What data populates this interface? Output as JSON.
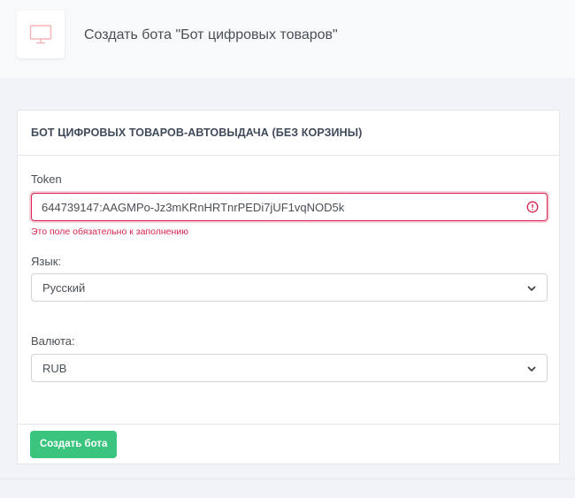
{
  "header": {
    "icon": "monitor-icon",
    "title": "Создать бота \"Бот цифровых товаров\""
  },
  "card": {
    "title": "БОТ ЦИФРОВЫХ ТОВАРОВ-АВТОВЫДАЧА (БЕЗ КОРЗИНЫ)",
    "token": {
      "label": "Token",
      "value": "644739147:AAGMPo-Jz3mKRnHRTnrPEDi7jUF1vqNOD5k",
      "error": "Это поле обязательно к заполнению"
    },
    "language": {
      "label": "Язык:",
      "selected": "Русский"
    },
    "currency": {
      "label": "Валюта:",
      "selected": "RUB"
    },
    "submit_label": "Создать бота"
  },
  "colors": {
    "error": "#d92550",
    "success": "#3ac47d",
    "icon_pink": "#f7b2b6"
  }
}
